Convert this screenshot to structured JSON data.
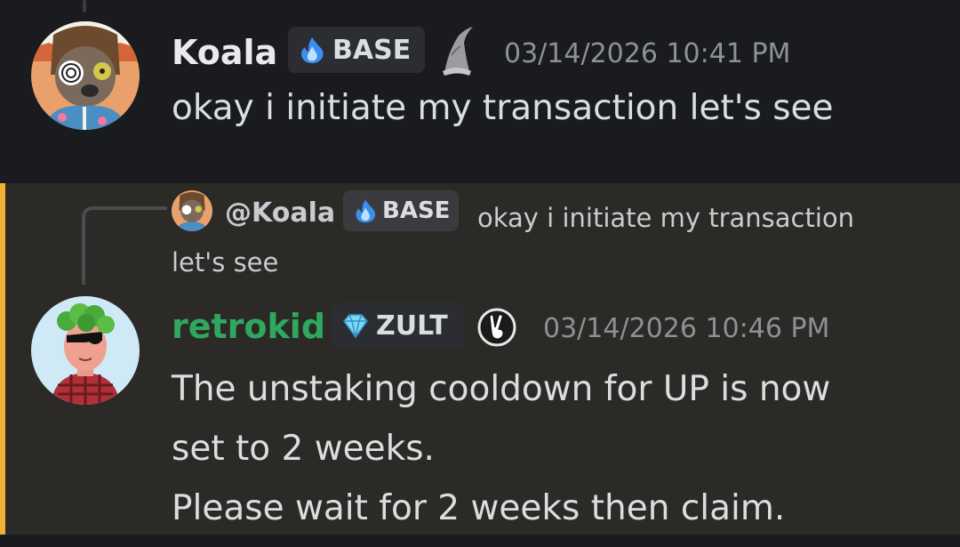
{
  "messages": [
    {
      "username": "Koala",
      "tag": "BASE",
      "timestamp": "03/14/2026 10:41 PM",
      "content": "okay i initiate my transaction let's see",
      "username_color": "#e9eaec"
    },
    {
      "username": "retrokid",
      "tag": "ZULT",
      "timestamp": "03/14/2026 10:46 PM",
      "username_color": "#2ea85e",
      "reply": {
        "mention": "@Koala",
        "tag": "BASE",
        "text": "okay i initiate my transaction let's see"
      },
      "content_lines": [
        "The unstaking cooldown for UP is now",
        "set to 2 weeks.",
        "Please wait for 2 weeks then claim."
      ]
    }
  ],
  "colors": {
    "background": "#1a1b1f",
    "highlight_background": "#2c2a27",
    "mention_accent": "#f0b232",
    "timestamp": "#8e9097"
  },
  "icons": {
    "base_tag": "blue-flame-icon",
    "zult_tag": "diamond-icon",
    "koala_badge": "wizard-hat-icon",
    "retrokid_badge": "peace-hand-icon"
  }
}
